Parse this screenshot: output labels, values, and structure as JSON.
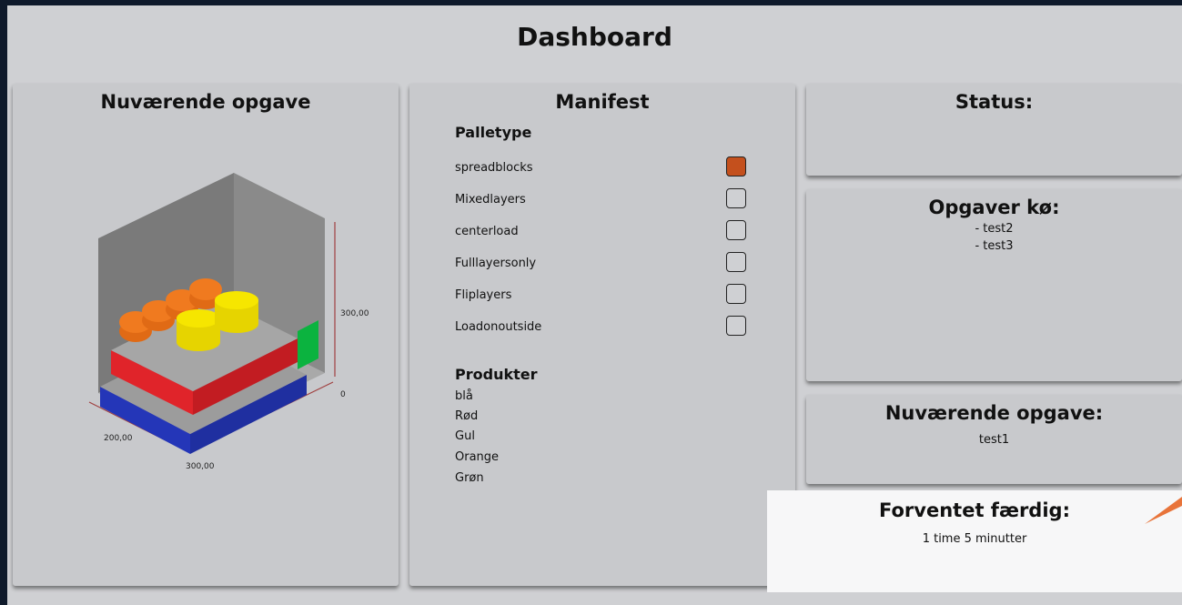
{
  "app": {
    "title": "Dashboard"
  },
  "left_panel": {
    "title": "Nuværende opgave",
    "visualization": {
      "axis_labels": {
        "height_top": "300,00",
        "height_zero": "0",
        "depth": "200,00",
        "width": "300,00"
      },
      "colors": {
        "blue": "#2b3fd0",
        "red": "#e0242a",
        "yellow": "#f2e000",
        "orange": "#f07a1f",
        "green": "#0bb33f",
        "grey": "#9b9b9b"
      }
    }
  },
  "manifest": {
    "title": "Manifest",
    "palletype_heading": "Palletype",
    "options": [
      {
        "label": "spreadblocks",
        "checked": true
      },
      {
        "label": "Mixedlayers",
        "checked": false
      },
      {
        "label": "centerload",
        "checked": false
      },
      {
        "label": "Fulllayersonly",
        "checked": false
      },
      {
        "label": "Fliplayers",
        "checked": false
      },
      {
        "label": "Loadonoutside",
        "checked": false
      }
    ],
    "products_heading": "Produkter",
    "products": [
      "blå",
      "Rød",
      "Gul",
      "Orange",
      "Grøn"
    ]
  },
  "status": {
    "title": "Status:"
  },
  "queue": {
    "title": "Opgaver kø:",
    "items": [
      "- test2",
      "- test3"
    ]
  },
  "current_task": {
    "title": "Nuværende opgave:",
    "value": "test1"
  },
  "eta": {
    "title": "Forventet færdig:",
    "value": "1 time 5 minutter"
  },
  "colors": {
    "checked_box": "#c4501d",
    "accent": "#e8743a"
  }
}
